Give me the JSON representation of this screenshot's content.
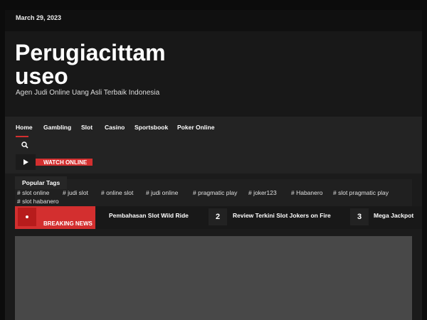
{
  "topbar": {
    "date": "March 29, 2023"
  },
  "header": {
    "title": "Perugiacittamuseo",
    "tagline": "Agen Judi Online Uang Asli Terbaik Indonesia"
  },
  "nav": {
    "items": [
      {
        "label": "Home"
      },
      {
        "label": "Gambling"
      },
      {
        "label": "Slot"
      },
      {
        "label": "Casino"
      },
      {
        "label": "Sportsbook"
      },
      {
        "label": "Poker Online"
      }
    ],
    "watch_label": "WATCH ONLINE"
  },
  "tags": {
    "title": "Popular Tags",
    "items": [
      "# slot online",
      "# judi slot",
      "# online slot",
      "# judi online",
      "# pragmatic play",
      "# joker123",
      "# Habanero",
      "# slot pragmatic play",
      "# slot habanero"
    ]
  },
  "breaking": {
    "label": "BREAKING NEWS",
    "items": [
      {
        "title": "Pembahasan Slot Wild Ride"
      },
      {
        "num": "2",
        "title": "Review Terkini Slot Jokers on Fire"
      },
      {
        "num": "3",
        "title": "Mega Jackpot"
      }
    ]
  },
  "colors": {
    "accent": "#d32f2f",
    "background": "#0c0c0c",
    "panel": "#1b1b1b"
  }
}
